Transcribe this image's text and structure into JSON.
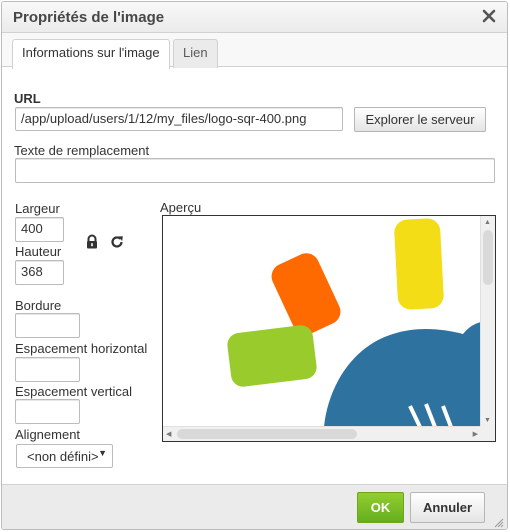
{
  "dialog": {
    "title": "Propriétés de l'image",
    "close_icon": "close-icon"
  },
  "tabs": [
    {
      "label": "Informations sur l'image",
      "active": true
    },
    {
      "label": "Lien",
      "active": false
    }
  ],
  "url": {
    "label": "URL",
    "value": "/app/upload/users/1/12/my_files/logo-sqr-400.png",
    "browse_label": "Explorer le serveur"
  },
  "alt": {
    "label": "Texte de remplacement",
    "value": ""
  },
  "size": {
    "width_label": "Largeur",
    "width_value": "400",
    "height_label": "Hauteur",
    "height_value": "368",
    "lock_icon": "lock-icon",
    "reset_icon": "reset-size-icon"
  },
  "border": {
    "label": "Bordure",
    "value": ""
  },
  "hspace": {
    "label": "Espacement horizontal",
    "value": ""
  },
  "vspace": {
    "label": "Espacement vertical",
    "value": ""
  },
  "align": {
    "label": "Alignement",
    "selected": "<non défini>"
  },
  "preview": {
    "label": "Aperçu",
    "image": "logo-sqr-400",
    "colors": {
      "orange": "#ff6a00",
      "yellow": "#f2dd16",
      "green": "#9acb2c",
      "blue": "#2e72a0"
    }
  },
  "footer": {
    "ok_label": "OK",
    "cancel_label": "Annuler",
    "ok_color": "#7ab526"
  }
}
